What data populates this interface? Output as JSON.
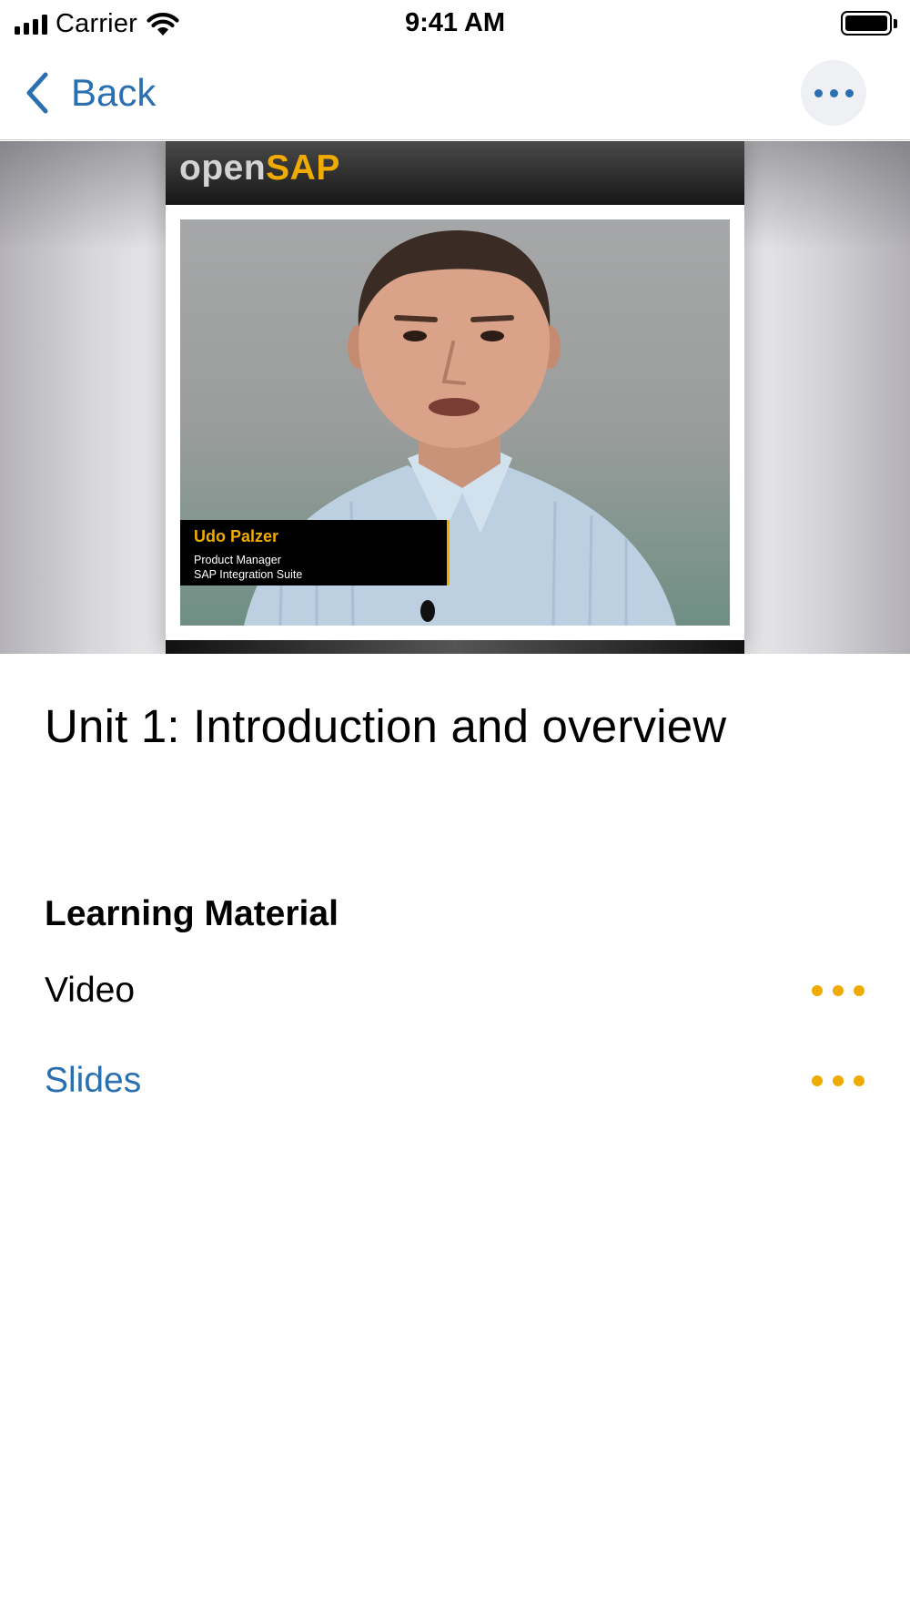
{
  "status_bar": {
    "carrier": "Carrier",
    "time": "9:41 AM"
  },
  "nav": {
    "back_label": "Back"
  },
  "video": {
    "logo_open": "open",
    "logo_sap": "SAP",
    "speaker_name": "Udo Palzer",
    "speaker_role": "Product Manager",
    "speaker_org": "SAP Integration Suite"
  },
  "unit": {
    "title": "Unit 1: Introduction and overview"
  },
  "learning_material": {
    "heading": "Learning Material",
    "items": [
      {
        "label": "Video"
      },
      {
        "label": "Slides"
      }
    ]
  },
  "colors": {
    "accent": "#2a6fb0",
    "brand": "#f0ab00"
  }
}
